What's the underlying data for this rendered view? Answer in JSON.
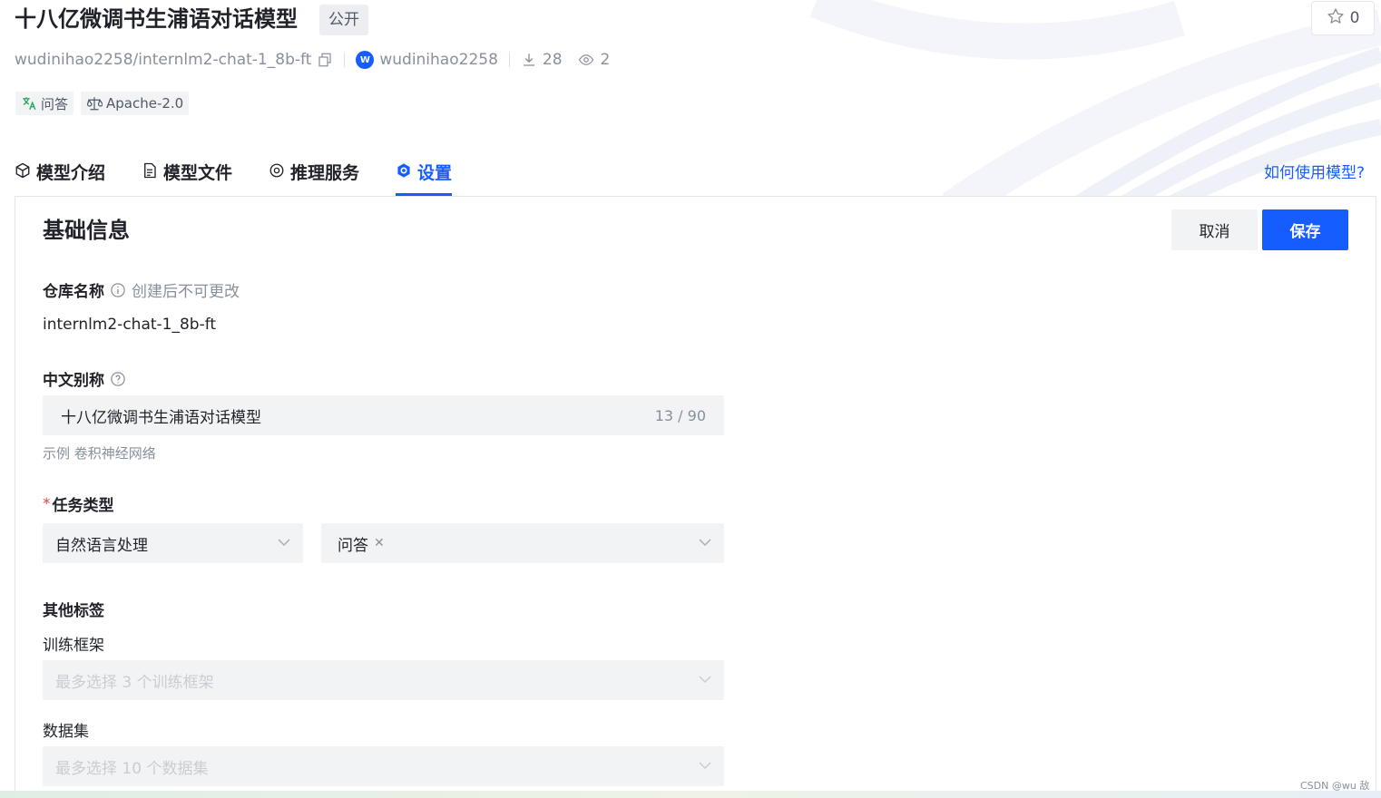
{
  "header": {
    "title": "十八亿微调书生浦语对话模型",
    "visibility": "公开",
    "star_count": "0",
    "repo_path": "wudinihao2258/internlm2-chat-1_8b-ft",
    "owner_initial": "W",
    "owner": "wudinihao2258",
    "downloads": "28",
    "views": "2"
  },
  "tags": [
    {
      "label": "问答",
      "icon": "translate-icon"
    },
    {
      "label": "Apache-2.0",
      "icon": "scale-icon"
    }
  ],
  "tabs": [
    {
      "label": "模型介绍",
      "icon": "cube-icon",
      "active": false
    },
    {
      "label": "模型文件",
      "icon": "file-icon",
      "active": false
    },
    {
      "label": "推理服务",
      "icon": "service-icon",
      "active": false
    },
    {
      "label": "设置",
      "icon": "settings-icon",
      "active": true
    }
  ],
  "help_link": "如何使用模型?",
  "settings": {
    "section_title": "基础信息",
    "cancel_label": "取消",
    "save_label": "保存",
    "repo_name_label": "仓库名称",
    "repo_name_hint": "创建后不可更改",
    "repo_name_value": "internlm2-chat-1_8b-ft",
    "cn_alias_label": "中文别称",
    "cn_alias_value": "十八亿微调书生浦语对话模型",
    "cn_alias_counter": "13 / 90",
    "cn_alias_example": "示例 卷积神经网络",
    "task_type_label": "任务类型",
    "task_type_required": "*",
    "task_category": "自然语言处理",
    "task_chip": "问答",
    "other_tags_label": "其他标签",
    "framework_label": "训练框架",
    "framework_placeholder": "最多选择 3 个训练框架",
    "dataset_label": "数据集",
    "dataset_placeholder": "最多选择 10 个数据集"
  },
  "watermark": "CSDN @wu 敌",
  "colors": {
    "accent": "#165dff",
    "required": "#f53f3f",
    "field_bg": "#f2f3f5"
  }
}
